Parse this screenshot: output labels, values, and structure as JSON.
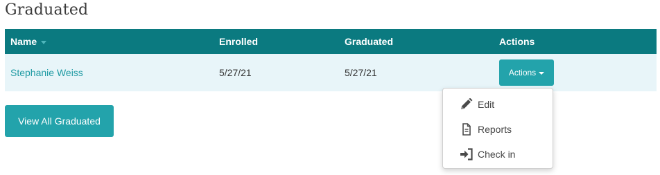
{
  "section": {
    "title": "Graduated"
  },
  "table": {
    "headers": {
      "name": "Name",
      "enrolled": "Enrolled",
      "graduated": "Graduated",
      "actions": "Actions"
    },
    "rows": [
      {
        "name": "Stephanie Weiss",
        "enrolled": "5/27/21",
        "graduated": "5/27/21",
        "actions_label": "Actions"
      }
    ]
  },
  "dropdown": {
    "items": [
      {
        "label": "Edit",
        "icon": "pencil-icon"
      },
      {
        "label": "Reports",
        "icon": "document-icon"
      },
      {
        "label": "Check in",
        "icon": "sign-in-icon"
      }
    ]
  },
  "buttons": {
    "view_all": "View All Graduated"
  },
  "colors": {
    "header_bg": "#0b7a80",
    "accent": "#23a3ab",
    "row_bg": "#e8f5f9",
    "link": "#1f9aa3"
  }
}
